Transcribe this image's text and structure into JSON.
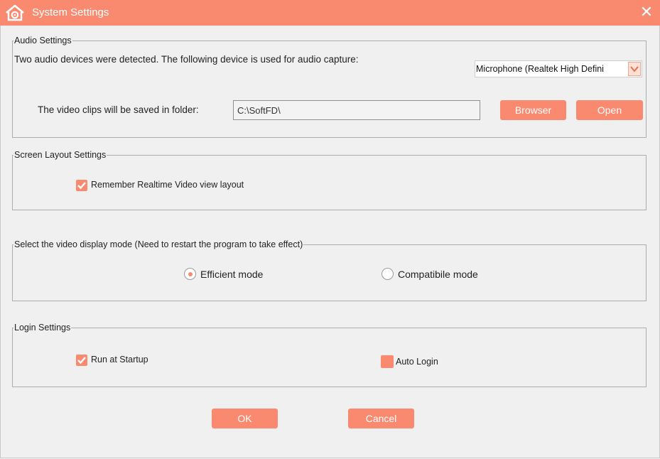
{
  "window": {
    "title": "System Settings",
    "app_icon": "house-camera-icon",
    "close_icon": "close-icon",
    "accent_color": "#f98a6f"
  },
  "audio": {
    "legend": "Audio Settings",
    "description": "Two audio devices were detected.  The following device is used for audio capture:",
    "device_selected": "Microphone (Realtek High Defini",
    "folder_label": "The video clips will be saved in folder:",
    "folder_path": "C:\\SoftFD\\",
    "browse_label": "Browser",
    "open_label": "Open"
  },
  "layout": {
    "legend": "Screen Layout Settings",
    "remember_label": "Remember Realtime Video view layout",
    "remember_checked": true
  },
  "display": {
    "legend": "Select the video display mode (Need to restart the program to take effect)",
    "efficient_label": "Efficient mode",
    "efficient_selected": true,
    "compatible_label": "Compatibile mode",
    "compatible_selected": false
  },
  "login": {
    "legend": "Login Settings",
    "startup_label": "Run at Startup",
    "startup_checked": true,
    "autologin_label": "Auto Login",
    "autologin_checked": false
  },
  "footer": {
    "ok_label": "OK",
    "cancel_label": "Cancel"
  }
}
